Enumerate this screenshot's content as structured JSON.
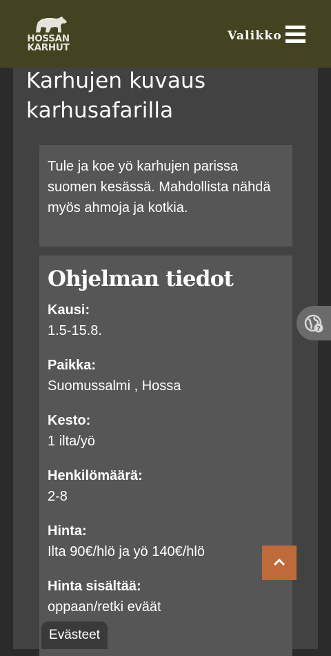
{
  "header": {
    "logo_line1": "HOSSAN",
    "logo_line2": "KARHUT",
    "menu_label": "Valikko"
  },
  "page": {
    "title": "Karhujen kuvaus karhusafarilla",
    "intro": "Tule ja koe yö karhujen parissa suomen kesässä. Mahdollista nähdä myös ahmoja ja kotkia."
  },
  "info": {
    "title": "Ohjelman tiedot",
    "fields": [
      {
        "label": "Kausi:",
        "value": "1.5-15.8."
      },
      {
        "label": "Paikka:",
        "value": "Suomussalmi , Hossa"
      },
      {
        "label": "Kesto:",
        "value": "1 ilta/yö"
      },
      {
        "label": "Henkilömäärä:",
        "value": "2-8"
      },
      {
        "label": "Hinta:",
        "value": "Ilta 90€/hlö ja yö 140€/hlö"
      },
      {
        "label": "Hinta sisältää:",
        "value": "oppaan/retki eväät"
      }
    ]
  },
  "widgets": {
    "cookies_label": "Evästeet",
    "language_icon": "globe-question-icon",
    "scroll_top_icon": "chevron-up-icon"
  },
  "colors": {
    "header_bg": "#434321",
    "page_bg": "#2b2b2b",
    "panel_bg": "#424242",
    "box_bg": "#565656",
    "accent": "#bf6a3a"
  }
}
